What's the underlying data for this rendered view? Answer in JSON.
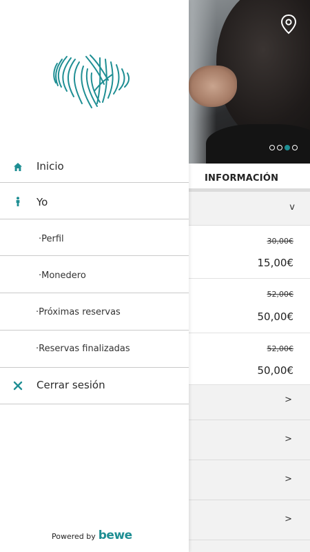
{
  "colors": {
    "accent": "#1e8e93",
    "divider": "#c9c9c9"
  },
  "drawer": {
    "logo_icon": "brand-wave-logo",
    "menu": [
      {
        "label": "Inicio",
        "icon": "home-icon"
      },
      {
        "label": "Yo",
        "icon": "person-icon"
      }
    ],
    "submenu": [
      {
        "label": "·Perfil"
      },
      {
        "label": "·Monedero"
      },
      {
        "label": "·Próximas reservas"
      },
      {
        "label": "·Reservas finalizadas"
      }
    ],
    "logout": {
      "label": "Cerrar sesión",
      "icon": "close-icon"
    },
    "footer": {
      "powered_by": "Powered by",
      "brand": "bewe"
    }
  },
  "background": {
    "hero": {
      "pin_icon": "location-pin-icon",
      "carousel_pages": 4,
      "carousel_active_index": 2
    },
    "info_title": "INFORMACIÓN",
    "accordion_chevron": "v",
    "prices": [
      {
        "old": "30,00€",
        "new": "15,00€"
      },
      {
        "old": "52,00€",
        "new": "50,00€"
      },
      {
        "old": "52,00€",
        "new": "50,00€"
      }
    ],
    "arrow_rows": [
      ">",
      ">",
      ">",
      ">"
    ]
  }
}
